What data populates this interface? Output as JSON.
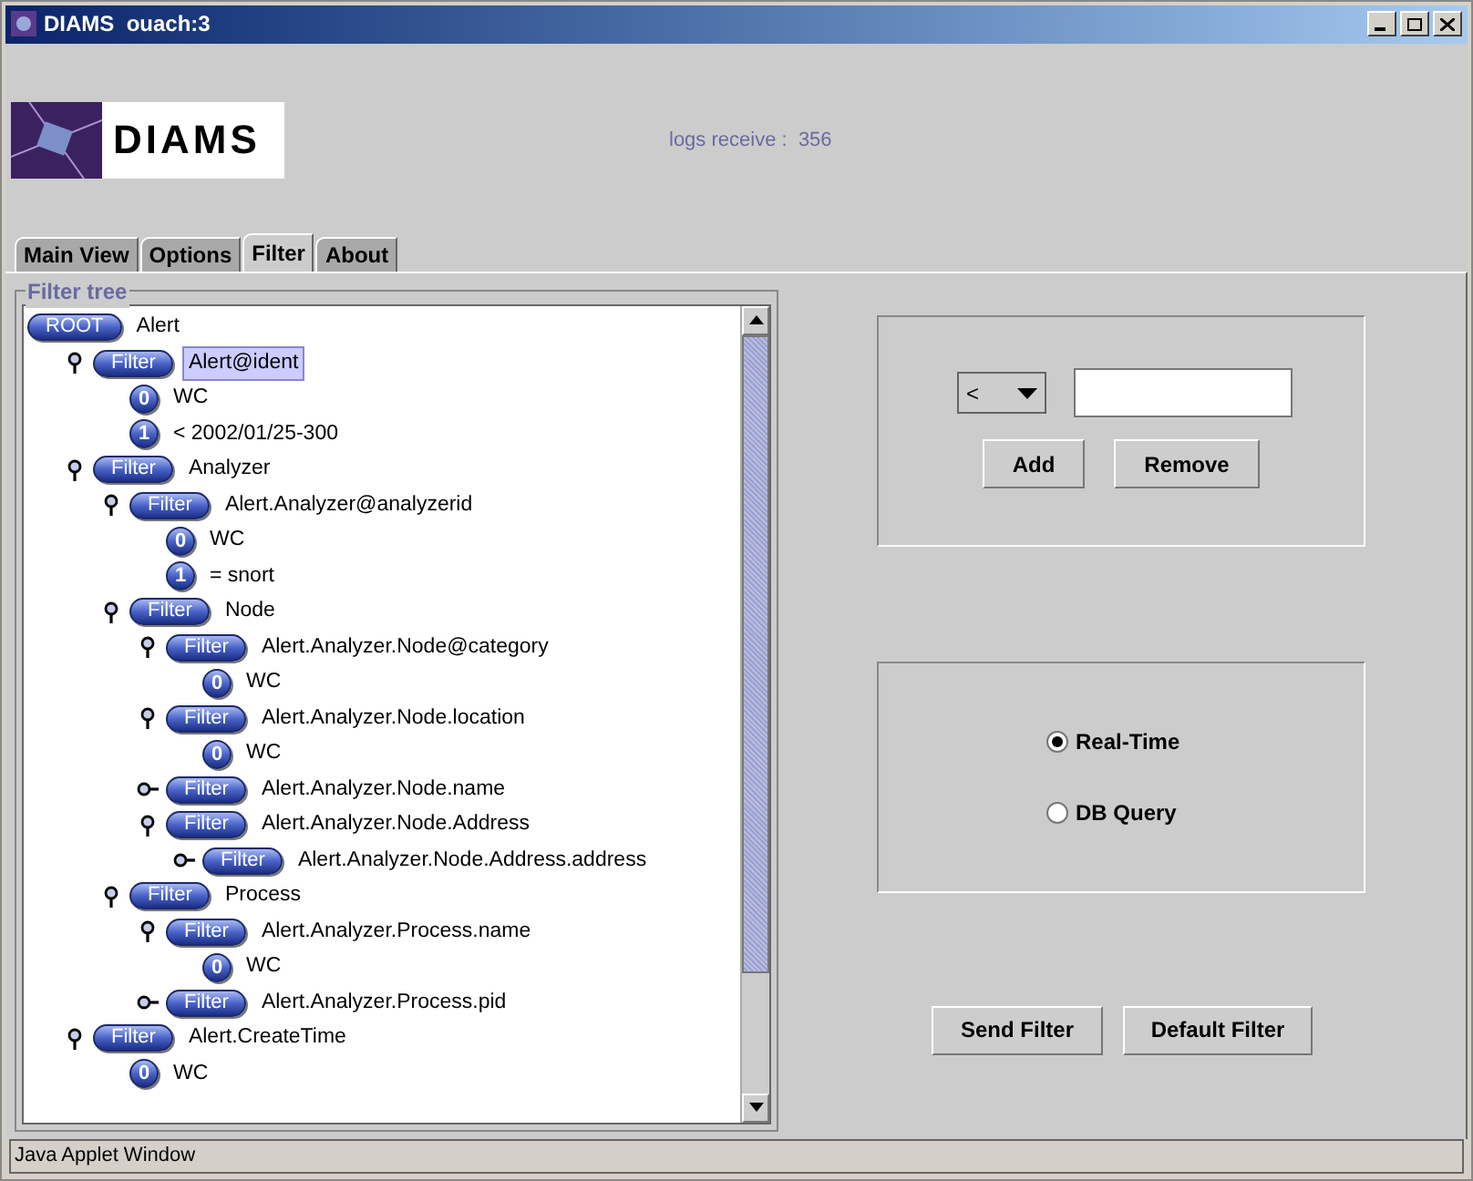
{
  "window": {
    "title": "DIAMS  ouach:3"
  },
  "header": {
    "logo_text": "DIAMS",
    "logs_label": "logs receive :",
    "logs_count": "356"
  },
  "tabs": [
    {
      "label": "Main View",
      "selected": false
    },
    {
      "label": "Options",
      "selected": false
    },
    {
      "label": "Filter",
      "selected": true
    },
    {
      "label": "About",
      "selected": false
    }
  ],
  "filter_tree": {
    "title": "Filter tree",
    "root": {
      "kind": "root",
      "badge": "ROOT",
      "label": "Alert",
      "selected": false,
      "children": [
        {
          "kind": "filter",
          "badge": "Filter",
          "label": "Alert@ident",
          "selected": true,
          "expanded": true,
          "children": [
            {
              "kind": "value",
              "badge": "0",
              "label": "WC",
              "selected": false
            },
            {
              "kind": "value",
              "badge": "1",
              "label": "< 2002/01/25-300",
              "selected": false
            }
          ]
        },
        {
          "kind": "filter",
          "badge": "Filter",
          "label": "Analyzer",
          "selected": false,
          "expanded": true,
          "children": [
            {
              "kind": "filter",
              "badge": "Filter",
              "label": "Alert.Analyzer@analyzerid",
              "selected": false,
              "expanded": true,
              "children": [
                {
                  "kind": "value",
                  "badge": "0",
                  "label": "WC",
                  "selected": false
                },
                {
                  "kind": "value",
                  "badge": "1",
                  "label": "= snort",
                  "selected": false
                }
              ]
            },
            {
              "kind": "filter",
              "badge": "Filter",
              "label": "Node",
              "selected": false,
              "expanded": true,
              "children": [
                {
                  "kind": "filter",
                  "badge": "Filter",
                  "label": "Alert.Analyzer.Node@category",
                  "selected": false,
                  "expanded": true,
                  "children": [
                    {
                      "kind": "value",
                      "badge": "0",
                      "label": "WC",
                      "selected": false
                    }
                  ]
                },
                {
                  "kind": "filter",
                  "badge": "Filter",
                  "label": "Alert.Analyzer.Node.location",
                  "selected": false,
                  "expanded": true,
                  "children": [
                    {
                      "kind": "value",
                      "badge": "0",
                      "label": "WC",
                      "selected": false
                    }
                  ]
                },
                {
                  "kind": "filter",
                  "badge": "Filter",
                  "label": "Alert.Analyzer.Node.name",
                  "selected": false,
                  "expanded": false
                },
                {
                  "kind": "filter",
                  "badge": "Filter",
                  "label": "Alert.Analyzer.Node.Address",
                  "selected": false,
                  "expanded": true,
                  "children": [
                    {
                      "kind": "filter",
                      "badge": "Filter",
                      "label": "Alert.Analyzer.Node.Address.address",
                      "selected": false,
                      "expanded": false
                    }
                  ]
                }
              ]
            },
            {
              "kind": "filter",
              "badge": "Filter",
              "label": "Process",
              "selected": false,
              "expanded": true,
              "children": [
                {
                  "kind": "filter",
                  "badge": "Filter",
                  "label": "Alert.Analyzer.Process.name",
                  "selected": false,
                  "expanded": true,
                  "children": [
                    {
                      "kind": "value",
                      "badge": "0",
                      "label": "WC",
                      "selected": false
                    }
                  ]
                },
                {
                  "kind": "filter",
                  "badge": "Filter",
                  "label": "Alert.Analyzer.Process.pid",
                  "selected": false,
                  "expanded": false
                }
              ]
            }
          ]
        },
        {
          "kind": "filter",
          "badge": "Filter",
          "label": "Alert.CreateTime",
          "selected": false,
          "expanded": true,
          "children": [
            {
              "kind": "value",
              "badge": "0",
              "label": "WC",
              "selected": false
            }
          ]
        }
      ]
    }
  },
  "condition_panel": {
    "operator": "<",
    "buttons": [
      "Add",
      "Remove"
    ]
  },
  "mode_panel": {
    "options": [
      {
        "label": "Real-Time",
        "selected": true
      },
      {
        "label": "DB Query",
        "selected": false
      }
    ]
  },
  "buttons": [
    "Send Filter",
    "Default Filter"
  ],
  "status_bar": "Java Applet Window"
}
